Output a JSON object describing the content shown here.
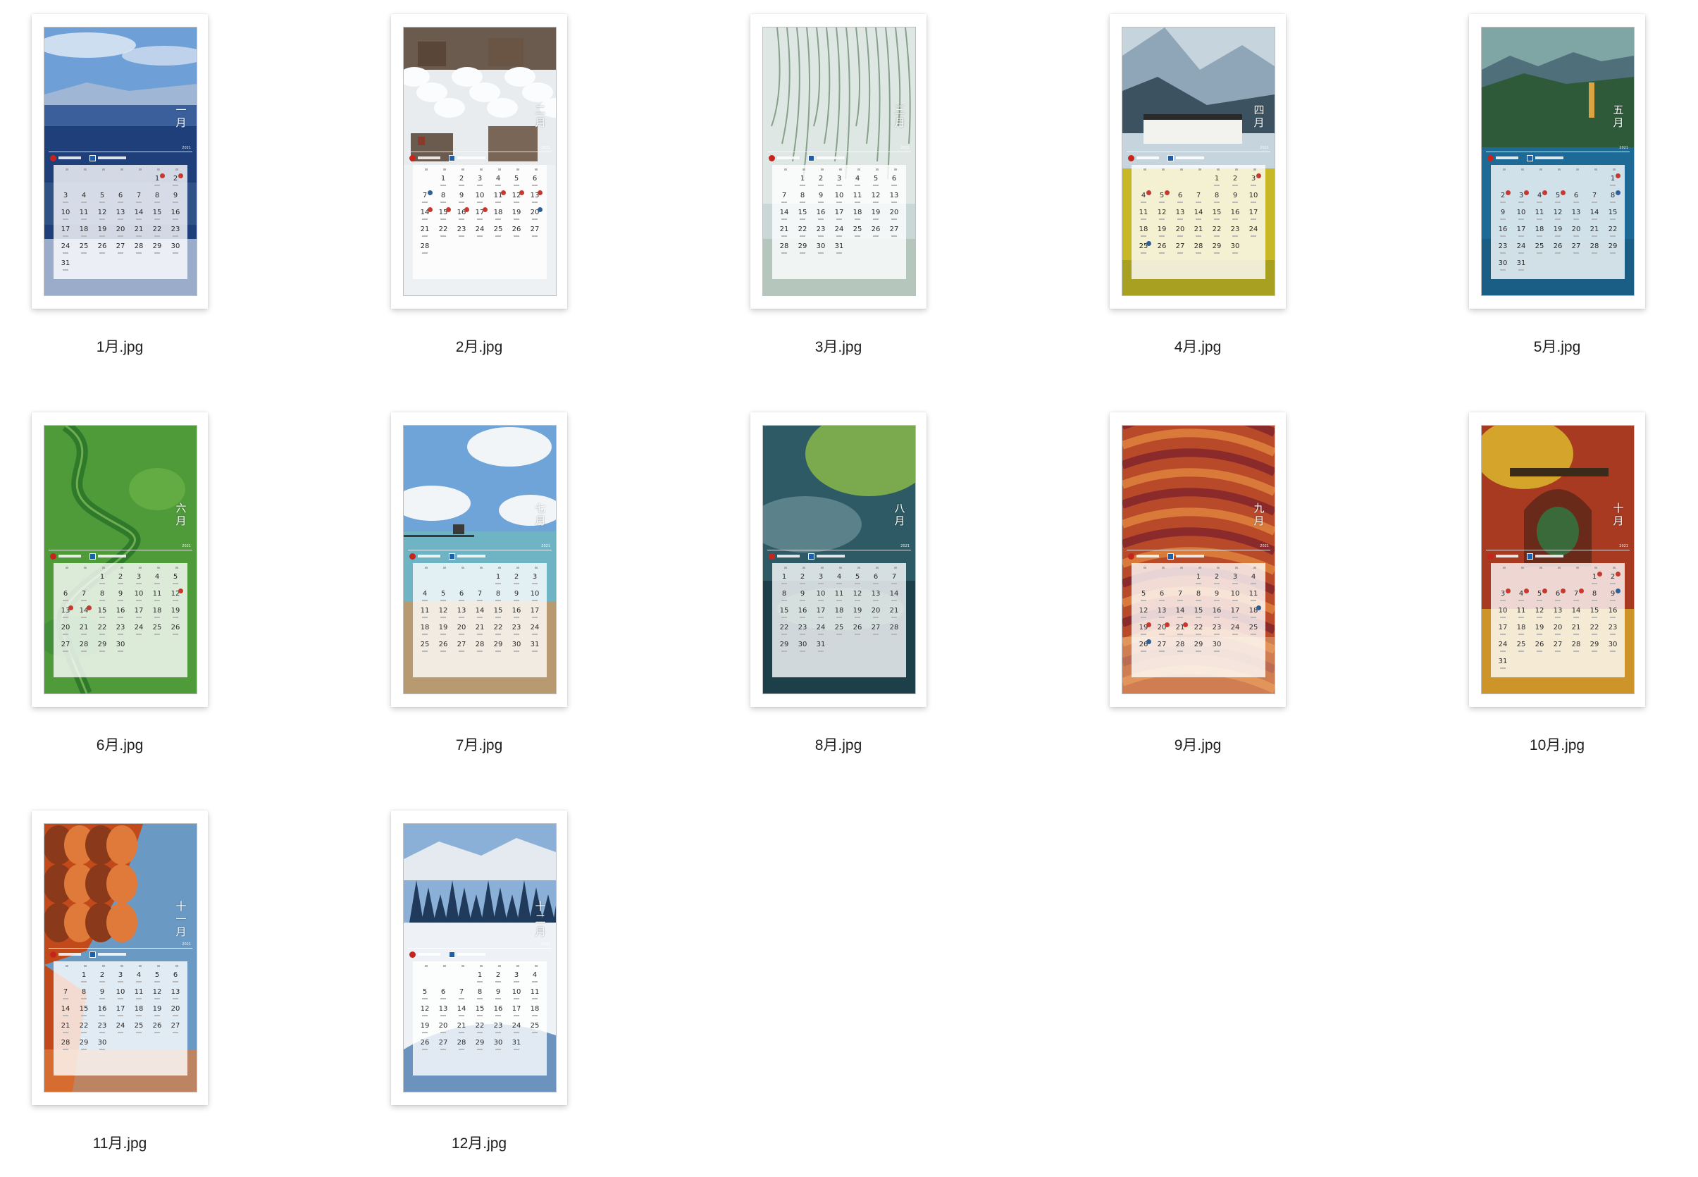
{
  "year_label": "2021",
  "weekday_count": 7,
  "files": [
    {
      "file_name": "1月.jpg",
      "month_name": "一月",
      "first_weekday": 5,
      "num_days": 31,
      "theme": "blue-lake",
      "colors": [
        "#6e9fd6",
        "#3a5f9a",
        "#1e3f7a",
        "#cfdcec"
      ],
      "holiday_marks": [
        {
          "day": 1,
          "tone": "red"
        },
        {
          "day": 2,
          "tone": "red"
        }
      ]
    },
    {
      "file_name": "2月.jpg",
      "month_name": "二月",
      "first_weekday": 1,
      "num_days": 28,
      "theme": "snow-village",
      "colors": [
        "#bfc3c6",
        "#6b5a4e",
        "#e9ecef",
        "#8a3a2a"
      ],
      "holiday_marks": [
        {
          "day": 7,
          "tone": "blue"
        },
        {
          "day": 11,
          "tone": "red"
        },
        {
          "day": 12,
          "tone": "red"
        },
        {
          "day": 13,
          "tone": "red"
        },
        {
          "day": 14,
          "tone": "red"
        },
        {
          "day": 15,
          "tone": "red"
        },
        {
          "day": 16,
          "tone": "red"
        },
        {
          "day": 17,
          "tone": "red"
        },
        {
          "day": 20,
          "tone": "blue"
        }
      ]
    },
    {
      "file_name": "3月.jpg",
      "month_name": "三月",
      "first_weekday": 1,
      "num_days": 31,
      "theme": "willow",
      "colors": [
        "#c9d8d6",
        "#8fa58e",
        "#6f8f74",
        "#dfe7e5"
      ],
      "holiday_marks": []
    },
    {
      "file_name": "4月.jpg",
      "month_name": "四月",
      "first_weekday": 4,
      "num_days": 30,
      "theme": "village-rapeseed",
      "colors": [
        "#8fa6b8",
        "#3c5260",
        "#c8b827",
        "#f2f2ee"
      ],
      "holiday_marks": [
        {
          "day": 3,
          "tone": "red"
        },
        {
          "day": 4,
          "tone": "red"
        },
        {
          "day": 5,
          "tone": "red"
        },
        {
          "day": 25,
          "tone": "blue"
        }
      ]
    },
    {
      "file_name": "5月.jpg",
      "month_name": "五月",
      "first_weekday": 6,
      "num_days": 31,
      "theme": "lake-pagoda",
      "colors": [
        "#7fa6a4",
        "#2f5a3a",
        "#1c6a95",
        "#d9a441"
      ],
      "holiday_marks": [
        {
          "day": 1,
          "tone": "red"
        },
        {
          "day": 2,
          "tone": "red"
        },
        {
          "day": 3,
          "tone": "red"
        },
        {
          "day": 4,
          "tone": "red"
        },
        {
          "day": 5,
          "tone": "red"
        },
        {
          "day": 8,
          "tone": "blue"
        }
      ]
    },
    {
      "file_name": "6月.jpg",
      "month_name": "六月",
      "first_weekday": 2,
      "num_days": 30,
      "theme": "green-river",
      "colors": [
        "#4f9b3a",
        "#2f7a2a",
        "#6fb84a",
        "#3a8a3a"
      ],
      "holiday_marks": [
        {
          "day": 12,
          "tone": "red"
        },
        {
          "day": 13,
          "tone": "red"
        },
        {
          "day": 14,
          "tone": "red"
        }
      ]
    },
    {
      "file_name": "7月.jpg",
      "month_name": "七月",
      "first_weekday": 4,
      "num_days": 31,
      "theme": "seaside-pier",
      "colors": [
        "#6ea4d8",
        "#f2f5f8",
        "#6fb4c4",
        "#b79a70"
      ],
      "holiday_marks": []
    },
    {
      "file_name": "8月.jpg",
      "month_name": "八月",
      "first_weekday": 0,
      "num_days": 31,
      "theme": "misty-teal",
      "colors": [
        "#2d5a64",
        "#3f7a6a",
        "#8ab84a",
        "#1d3f4a"
      ],
      "holiday_marks": []
    },
    {
      "file_name": "9月.jpg",
      "month_name": "九月",
      "first_weekday": 3,
      "num_days": 30,
      "theme": "danxia",
      "colors": [
        "#b84a2a",
        "#d97a3a",
        "#8a2a2a",
        "#e9b07a"
      ],
      "holiday_marks": [
        {
          "day": 18,
          "tone": "blue"
        },
        {
          "day": 19,
          "tone": "red"
        },
        {
          "day": 20,
          "tone": "red"
        },
        {
          "day": 21,
          "tone": "red"
        },
        {
          "day": 26,
          "tone": "blue"
        }
      ]
    },
    {
      "file_name": "10月.jpg",
      "month_name": "十月",
      "first_weekday": 5,
      "num_days": 31,
      "theme": "red-gate",
      "colors": [
        "#a83a22",
        "#d4a52a",
        "#6a2a1a",
        "#3a6a3a"
      ],
      "holiday_marks": [
        {
          "day": 1,
          "tone": "red"
        },
        {
          "day": 2,
          "tone": "red"
        },
        {
          "day": 3,
          "tone": "red"
        },
        {
          "day": 4,
          "tone": "red"
        },
        {
          "day": 5,
          "tone": "red"
        },
        {
          "day": 6,
          "tone": "red"
        },
        {
          "day": 7,
          "tone": "red"
        },
        {
          "day": 9,
          "tone": "blue"
        }
      ]
    },
    {
      "file_name": "11月.jpg",
      "month_name": "十一月",
      "first_weekday": 1,
      "num_days": 30,
      "theme": "autumn-lake",
      "colors": [
        "#c24a1a",
        "#e07a3a",
        "#6a9ac4",
        "#8a3a1a"
      ],
      "holiday_marks": []
    },
    {
      "file_name": "12月.jpg",
      "month_name": "十二月",
      "first_weekday": 3,
      "num_days": 31,
      "theme": "snow-forest",
      "colors": [
        "#8ab0d8",
        "#1f3a5a",
        "#eef2f6",
        "#4a7ab0"
      ],
      "holiday_marks": []
    }
  ]
}
